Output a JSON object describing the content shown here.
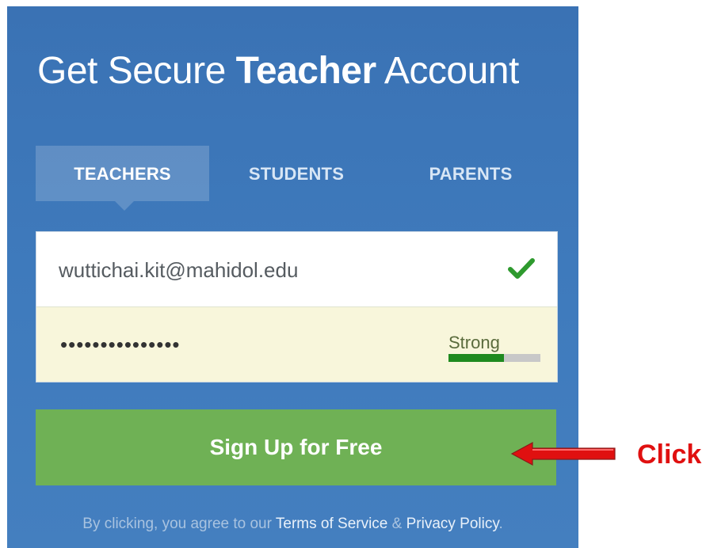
{
  "heading": {
    "prefix": "Get Secure ",
    "emphasis": "Teacher",
    "suffix": " Account"
  },
  "tabs": [
    {
      "label": "TEACHERS",
      "active": true
    },
    {
      "label": "STUDENTS",
      "active": false
    },
    {
      "label": "PARENTS",
      "active": false
    }
  ],
  "form": {
    "email_value": "wuttichai.kit@mahidol.edu",
    "email_status_icon": "check-icon",
    "password_masked": "•••••••••••••••",
    "strength": {
      "label": "Strong",
      "level": 0.6
    }
  },
  "signup_button": {
    "label": "Sign Up for Free"
  },
  "terms": {
    "prefix": "By clicking, you agree to our ",
    "terms_link": "Terms of Service",
    "connector": " & ",
    "privacy_link": "Privacy Policy",
    "suffix": "."
  },
  "annotation": {
    "label": "Click",
    "arrow_icon": "left-arrow-icon"
  },
  "colors": {
    "panel": "#3c76b8",
    "button": "#6fb155",
    "check": "#2e9a2e",
    "strength_fill": "#1f8a1f",
    "password_bg": "#f8f6db",
    "annotation": "#e01010"
  }
}
